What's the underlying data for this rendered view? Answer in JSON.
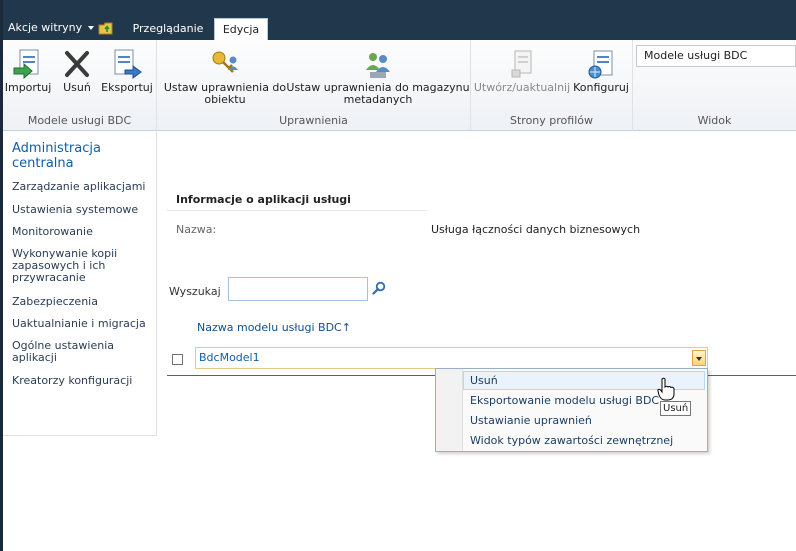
{
  "topbar": {
    "site_actions": "Akcje witryny",
    "tabs": [
      "Przeglądanie",
      "Edycja"
    ]
  },
  "ribbon": {
    "groups": [
      {
        "label": "Modele usługi BDC",
        "buttons": [
          "Importuj",
          "Usuń",
          "Eksportuj"
        ]
      },
      {
        "label": "Uprawnienia",
        "buttons": [
          "Ustaw uprawnienia do obiektu",
          "Ustaw uprawnienia do magazynu metadanych"
        ]
      },
      {
        "label": "Strony profilów",
        "buttons": [
          "Utwórz/uaktualnij",
          "Konfiguruj"
        ]
      },
      {
        "label": "Widok",
        "select_value": "Modele usługi BDC"
      }
    ]
  },
  "leftnav": {
    "title": "Administracja centralna",
    "items": [
      "Zarządzanie aplikacjami",
      "Ustawienia systemowe",
      "Monitorowanie",
      "Wykonywanie kopii zapasowych i ich przywracanie",
      "Zabezpieczenia",
      "Uaktualnianie i migracja",
      "Ogólne ustawienia aplikacji",
      "Kreatorzy konfiguracji"
    ]
  },
  "main": {
    "info_header": "Informacje o aplikacji usługi",
    "name_label": "Nazwa:",
    "name_value": "Usługa łączności danych biznesowych",
    "search_label": "Wyszukaj",
    "column_header": "Nazwa modelu usługi BDC↑",
    "rows": [
      {
        "name": "BdcModel1"
      }
    ]
  },
  "context_menu": {
    "items": [
      "Usuń",
      "Eksportowanie modelu usługi BDC",
      "Ustawianie uprawnień",
      "Widok typów zawartości zewnętrznej"
    ]
  },
  "tooltip": "Usuń"
}
